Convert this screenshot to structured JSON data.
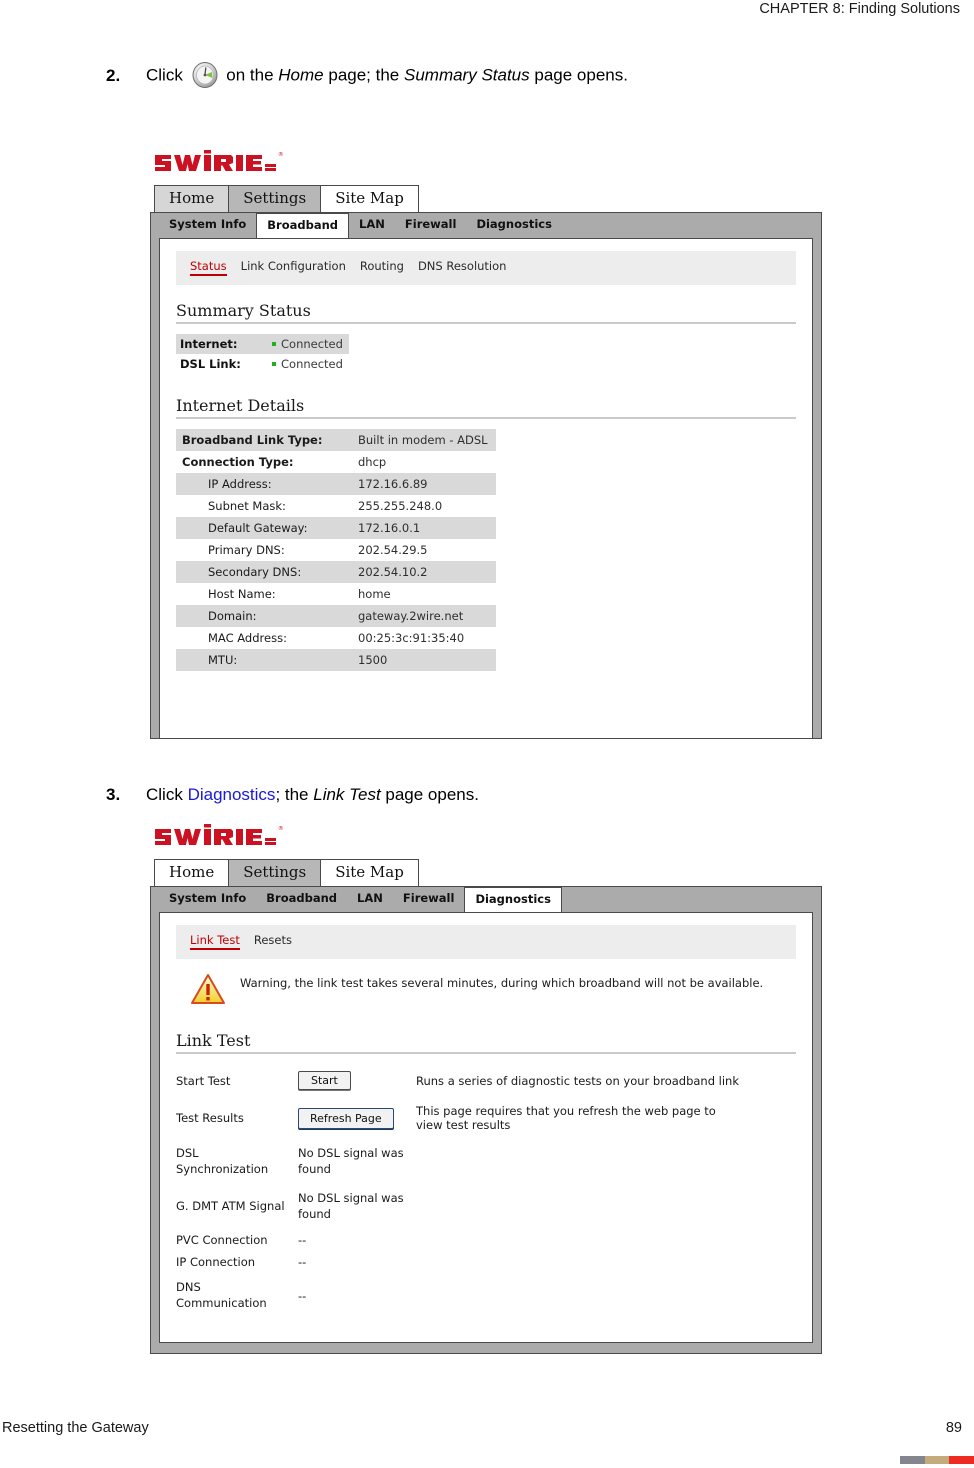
{
  "page": {
    "chapter_header": "CHAPTER 8: Finding Solutions",
    "footer_left": "Resetting the Gateway",
    "footer_page_number": "89",
    "footer_bar_colors": [
      "#85858f",
      "#c3ab7c",
      "#ee2b20"
    ]
  },
  "steps": [
    {
      "number": "2.",
      "prefix": "Click ",
      "icon": "gauge-icon",
      "segments": [
        {
          "text": " on the ",
          "style": "normal"
        },
        {
          "text": "Home",
          "style": "italic"
        },
        {
          "text": " page; the ",
          "style": "normal"
        },
        {
          "text": "Summary Status",
          "style": "italic"
        },
        {
          "text": " page opens.",
          "style": "normal"
        }
      ]
    },
    {
      "number": "3.",
      "prefix": "Click ",
      "segments": [
        {
          "text": "Diagnostics",
          "style": "link"
        },
        {
          "text": "; the ",
          "style": "normal"
        },
        {
          "text": "Link Test",
          "style": "italic"
        },
        {
          "text": " page opens.",
          "style": "normal"
        }
      ]
    }
  ],
  "capture1": {
    "logo_alt": "2WIRE",
    "top_tabs": [
      {
        "label": "Home",
        "state": "light"
      },
      {
        "label": "Settings",
        "state": "selected"
      },
      {
        "label": "Site Map",
        "state": "white"
      }
    ],
    "sub_tabs": [
      {
        "label": "System Info",
        "active": false
      },
      {
        "label": "Broadband",
        "active": true
      },
      {
        "label": "LAN",
        "active": false
      },
      {
        "label": "Firewall",
        "active": false
      },
      {
        "label": "Diagnostics",
        "active": false
      }
    ],
    "page_nav": [
      {
        "label": "Status",
        "selected": true
      },
      {
        "label": "Link Configuration",
        "selected": false
      },
      {
        "label": "Routing",
        "selected": false
      },
      {
        "label": "DNS Resolution",
        "selected": false
      }
    ],
    "summary_title": "Summary Status",
    "summary_rows": [
      {
        "label": "Internet:",
        "value": "Connected",
        "shaded": true,
        "dot": true
      },
      {
        "label": "DSL Link:",
        "value": "Connected",
        "shaded": false,
        "dot": true
      }
    ],
    "details_title": "Internet Details",
    "details_rows": [
      {
        "key": "Broadband Link Type:",
        "value": "Built in modem - ADSL",
        "shaded": true,
        "bold": true,
        "indent": false
      },
      {
        "key": "Connection Type:",
        "value": "dhcp",
        "shaded": false,
        "bold": true,
        "indent": false
      },
      {
        "key": "IP Address:",
        "value": "172.16.6.89",
        "shaded": true,
        "bold": false,
        "indent": true
      },
      {
        "key": "Subnet Mask:",
        "value": "255.255.248.0",
        "shaded": false,
        "bold": false,
        "indent": true
      },
      {
        "key": "Default Gateway:",
        "value": "172.16.0.1",
        "shaded": true,
        "bold": false,
        "indent": true
      },
      {
        "key": "Primary DNS:",
        "value": "202.54.29.5",
        "shaded": false,
        "bold": false,
        "indent": true
      },
      {
        "key": "Secondary DNS:",
        "value": "202.54.10.2",
        "shaded": true,
        "bold": false,
        "indent": true
      },
      {
        "key": "Host Name:",
        "value": "home",
        "shaded": false,
        "bold": false,
        "indent": true
      },
      {
        "key": "Domain:",
        "value": "gateway.2wire.net",
        "shaded": true,
        "bold": false,
        "indent": true
      },
      {
        "key": "MAC Address:",
        "value": "00:25:3c:91:35:40",
        "shaded": false,
        "bold": false,
        "indent": true
      },
      {
        "key": "MTU:",
        "value": "1500",
        "shaded": true,
        "bold": false,
        "indent": true
      }
    ]
  },
  "capture2": {
    "logo_alt": "2WIRE",
    "top_tabs": [
      {
        "label": "Home",
        "state": "white"
      },
      {
        "label": "Settings",
        "state": "selected"
      },
      {
        "label": "Site Map",
        "state": "white"
      }
    ],
    "sub_tabs": [
      {
        "label": "System Info",
        "active": false
      },
      {
        "label": "Broadband",
        "active": false
      },
      {
        "label": "LAN",
        "active": false
      },
      {
        "label": "Firewall",
        "active": false
      },
      {
        "label": "Diagnostics",
        "active": true
      }
    ],
    "page_nav": [
      {
        "label": "Link Test",
        "selected": true
      },
      {
        "label": "Resets",
        "selected": false
      }
    ],
    "warning_text": "Warning, the link test takes several minutes, during which broadband will not be available.",
    "warning_icon": "warning-triangle-icon",
    "section_title": "Link Test",
    "rows": [
      {
        "label": "Start Test",
        "button": "Start",
        "value": "",
        "desc": "Runs a series of diagnostic tests on your broadband link"
      },
      {
        "label": "Test Results",
        "button": "Refresh Page",
        "value": "",
        "desc": "This page requires that you refresh the web page to view test results"
      },
      {
        "label": "DSL Synchronization",
        "button": "",
        "value": "No DSL signal was found",
        "desc": ""
      },
      {
        "label": "G. DMT ATM Signal",
        "button": "",
        "value": "No DSL signal was found",
        "desc": ""
      },
      {
        "label": "PVC Connection",
        "button": "",
        "value": "--",
        "desc": ""
      },
      {
        "label": "IP Connection",
        "button": "",
        "value": "--",
        "desc": ""
      },
      {
        "label": "DNS Communication",
        "button": "",
        "value": "--",
        "desc": ""
      }
    ]
  }
}
